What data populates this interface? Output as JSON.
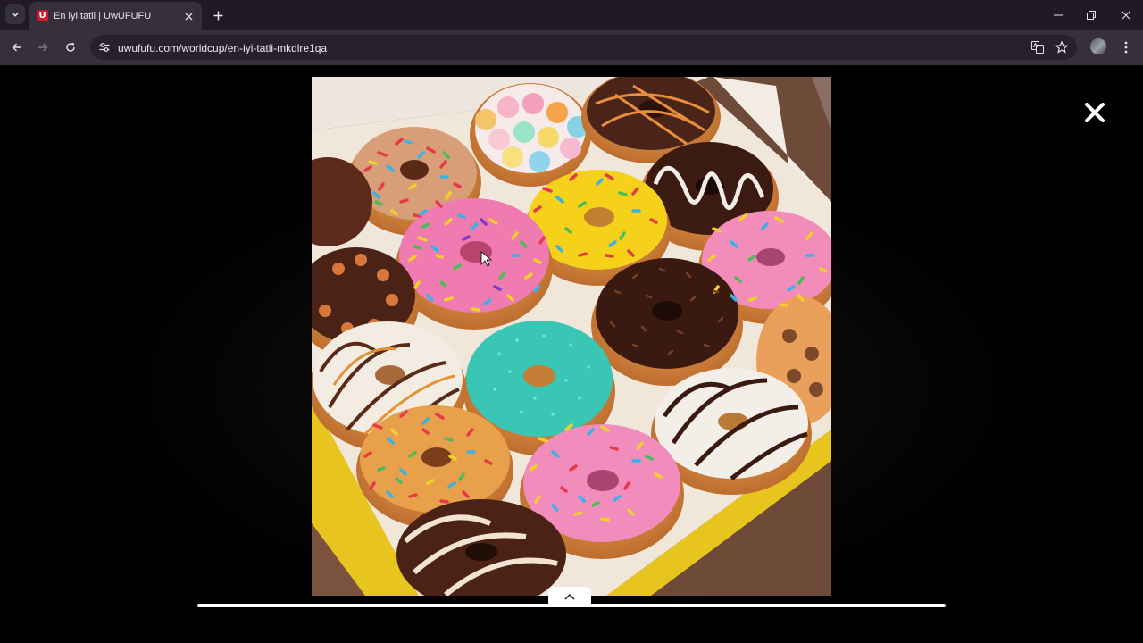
{
  "browser": {
    "tab_title": "En iyi tatli | UwUFUFU",
    "favicon_letter": "U",
    "favicon_color": "#d1182e",
    "url": "uwufufu.com/worldcup/en-iyi-tatli-mkdlre1qa"
  },
  "icons": {
    "tab_list": "chevron-down-icon",
    "tab_close": "close-icon",
    "new_tab": "plus-icon",
    "minimize": "minimize-icon",
    "restore": "restore-icon",
    "window_close": "close-icon",
    "back": "arrow-left-icon",
    "forward": "arrow-right-icon",
    "reload": "reload-icon",
    "site_info": "tune-icon",
    "translate": "translate-icon",
    "bookmark": "star-icon",
    "menu": "kebab-menu-icon",
    "viewer_close": "close-icon",
    "collapse": "chevron-up-icon"
  },
  "viewer": {
    "image_subject": "donut-box-photo"
  },
  "colors": {
    "chrome_dark": "#1f1a26",
    "chrome_toolbar": "#35303c",
    "page_background": "#000000"
  }
}
